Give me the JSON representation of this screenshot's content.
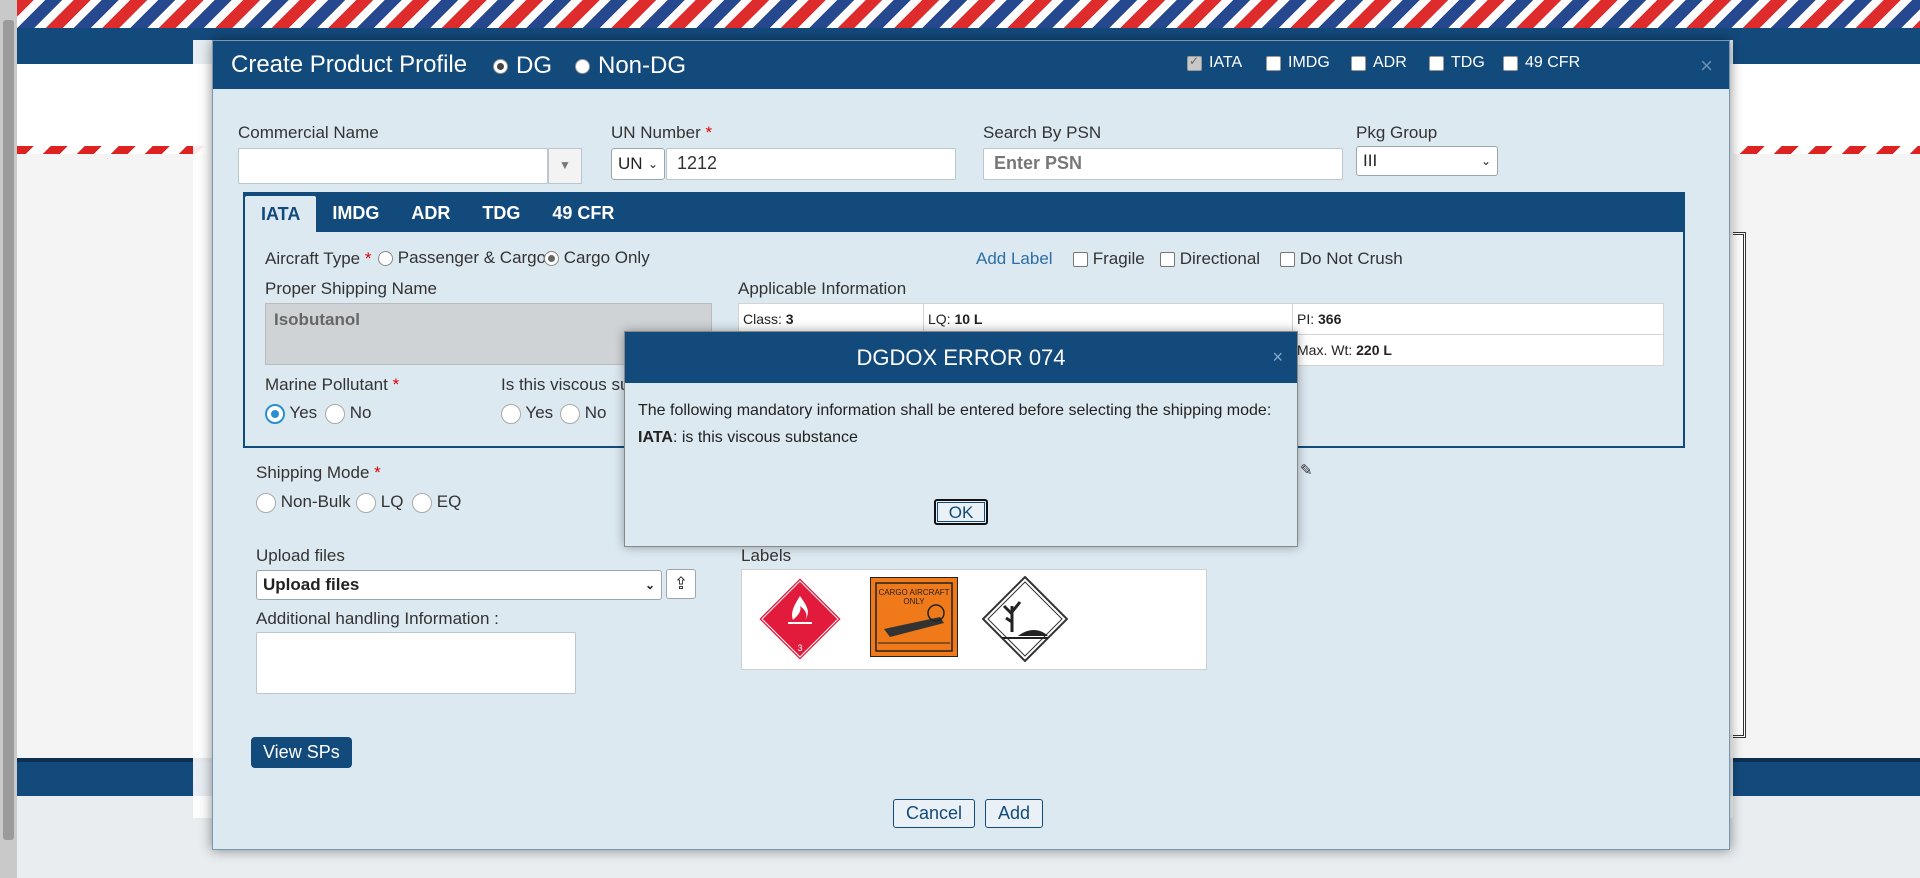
{
  "modal": {
    "title": "Create Product Profile",
    "mode_dg": "DG",
    "mode_nondg": "Non-DG",
    "header_checks": [
      "IATA",
      "IMDG",
      "ADR",
      "TDG",
      "49 CFR"
    ],
    "close": "×"
  },
  "fields": {
    "commercial_name_label": "Commercial Name",
    "commercial_name_value": "",
    "un_number_label": "UN Number",
    "un_prefix": "UN",
    "un_value": "1212",
    "search_psn_label": "Search By PSN",
    "search_psn_placeholder": "Enter PSN",
    "pkg_group_label": "Pkg Group",
    "pkg_group_value": "III"
  },
  "tabs": [
    "IATA",
    "IMDG",
    "ADR",
    "TDG",
    "49 CFR"
  ],
  "iata": {
    "aircraft_type_label": "Aircraft Type",
    "aircraft_passenger": "Passenger & Cargo",
    "aircraft_cargo": "Cargo Only",
    "add_label": "Add Label",
    "label_fragile": "Fragile",
    "label_directional": "Directional",
    "label_do_not_crush": "Do Not Crush",
    "psn_label": "Proper Shipping Name",
    "psn_value": "Isobutanol",
    "applicable_label": "Applicable Information",
    "class_label": "Class:",
    "class_value": "3",
    "lq_label": "LQ:",
    "lq_value": "10 L",
    "pi_label": "PI:",
    "pi_value": "366",
    "maxwt_label": "Max. Wt:",
    "maxwt_value": "220 L",
    "marine_label": "Marine Pollutant",
    "viscous_label": "Is this viscous su",
    "yes": "Yes",
    "no": "No"
  },
  "shipping": {
    "label": "Shipping Mode",
    "options": [
      "Non-Bulk",
      "LQ",
      "EQ"
    ]
  },
  "upload": {
    "label": "Upload files",
    "select_value": "Upload files",
    "additional_label": "Additional handling Information :",
    "labels_title": "Labels"
  },
  "buttons": {
    "view_sps": "View SPs",
    "cancel": "Cancel",
    "add": "Add"
  },
  "error": {
    "title": "DGDOX ERROR 074",
    "message": "The following mandatory information shall be entered before selecting the shipping mode:",
    "detail_key": "IATA",
    "detail_text": ": is this viscous substance",
    "ok": "OK",
    "close": "×"
  },
  "label_images": {
    "flammable_class": "3",
    "cargo_line1": "CARGO AIRCRAFT",
    "cargo_line2": "ONLY"
  }
}
